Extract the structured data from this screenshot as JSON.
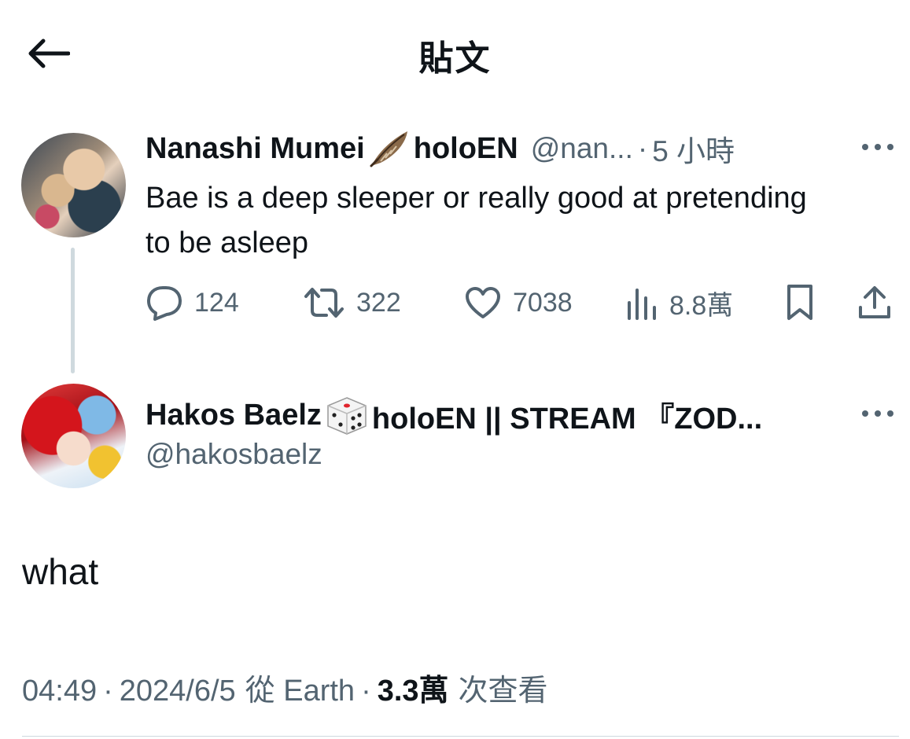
{
  "header": {
    "title": "貼文"
  },
  "quoted_tweet": {
    "author_name_prefix": "Nanashi Mumei",
    "author_name_suffix": "holoEN",
    "handle": "@nan...",
    "time": "5 小時",
    "text": "Bae is a deep sleeper or really good at pretending to be asleep",
    "stats": {
      "replies": "124",
      "retweets": "322",
      "likes": "7038",
      "views": "8.8萬"
    }
  },
  "main_tweet": {
    "author_name_prefix": "Hakos Baelz",
    "author_name_suffix": "holoEN || STREAM 『ZOD...",
    "handle": "@hakosbaelz",
    "text": "what",
    "time": "04:49",
    "date": "2024/6/5",
    "source": "從 Earth",
    "views_count": "3.3萬",
    "views_label": "次查看"
  },
  "icons": [
    "back-arrow-icon",
    "feather-emoji-icon",
    "dice-emoji-icon",
    "more-icon",
    "reply-icon",
    "retweet-icon",
    "like-icon",
    "views-icon",
    "bookmark-icon",
    "share-icon"
  ],
  "colors": {
    "text": "#0f1419",
    "secondary": "#536471",
    "divider": "#cfd9de"
  }
}
